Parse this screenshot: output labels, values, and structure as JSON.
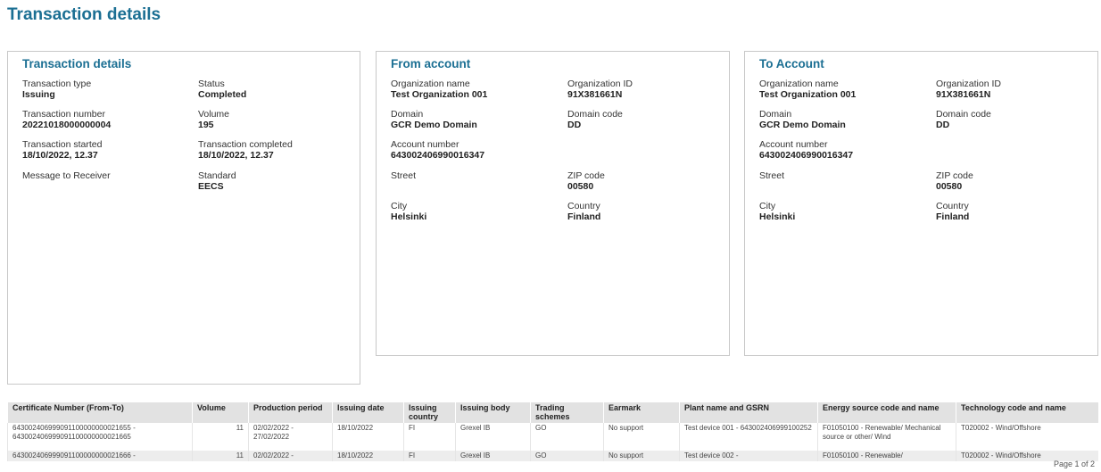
{
  "page_title": "Transaction details",
  "transaction": {
    "title": "Transaction details",
    "type_label": "Transaction type",
    "type_value": "Issuing",
    "status_label": "Status",
    "status_value": "Completed",
    "number_label": "Transaction number",
    "number_value": "20221018000000004",
    "volume_label": "Volume",
    "volume_value": "195",
    "started_label": "Transaction started",
    "started_value": "18/10/2022, 12.37",
    "completed_label": "Transaction completed",
    "completed_value": "18/10/2022, 12.37",
    "message_label": "Message to Receiver",
    "standard_label": "Standard",
    "standard_value": "EECS"
  },
  "from_account": {
    "title": "From account",
    "org_name_label": "Organization name",
    "org_name_value": "Test Organization 001",
    "org_id_label": "Organization ID",
    "org_id_value": "91X381661N",
    "domain_label": "Domain",
    "domain_value": "GCR Demo Domain",
    "domain_code_label": "Domain code",
    "domain_code_value": "DD",
    "account_label": "Account number",
    "account_value": "643002406990016347",
    "street_label": "Street",
    "zip_label": "ZIP code",
    "zip_value": "00580",
    "city_label": "City",
    "city_value": "Helsinki",
    "country_label": "Country",
    "country_value": "Finland"
  },
  "to_account": {
    "title": "To Account",
    "org_name_label": "Organization name",
    "org_name_value": "Test Organization 001",
    "org_id_label": "Organization ID",
    "org_id_value": "91X381661N",
    "domain_label": "Domain",
    "domain_value": "GCR Demo Domain",
    "domain_code_label": "Domain code",
    "domain_code_value": "DD",
    "account_label": "Account number",
    "account_value": "643002406990016347",
    "street_label": "Street",
    "zip_label": "ZIP code",
    "zip_value": "00580",
    "city_label": "City",
    "city_value": "Helsinki",
    "country_label": "Country",
    "country_value": "Finland"
  },
  "certificates": {
    "headers": [
      "Certificate Number (From-To)",
      "Volume",
      "Production period",
      "Issuing date",
      "Issuing country",
      "Issuing body",
      "Trading schemes",
      "Earmark",
      "Plant name and GSRN",
      "Energy source code and name",
      "Technology code and name"
    ],
    "rows": [
      [
        "643002406999091100000000021655 - 643002406999091100000000021665",
        "11",
        "02/02/2022 - 27/02/2022",
        "18/10/2022",
        "FI",
        "Grexel IB",
        "GO",
        "No support",
        "Test device 001 - 643002406999100252",
        "F01050100 - Renewable/ Mechanical source or other/ Wind",
        "T020002 - Wind/Offshore"
      ],
      [
        "643002406999091100000000021666 -",
        "11",
        "02/02/2022 -",
        "18/10/2022",
        "FI",
        "Grexel IB",
        "GO",
        "No support",
        "Test device 002 -",
        "F01050100 - Renewable/",
        "T020002 - Wind/Offshore"
      ]
    ]
  },
  "footer": {
    "page": "Page 1 of 2"
  }
}
